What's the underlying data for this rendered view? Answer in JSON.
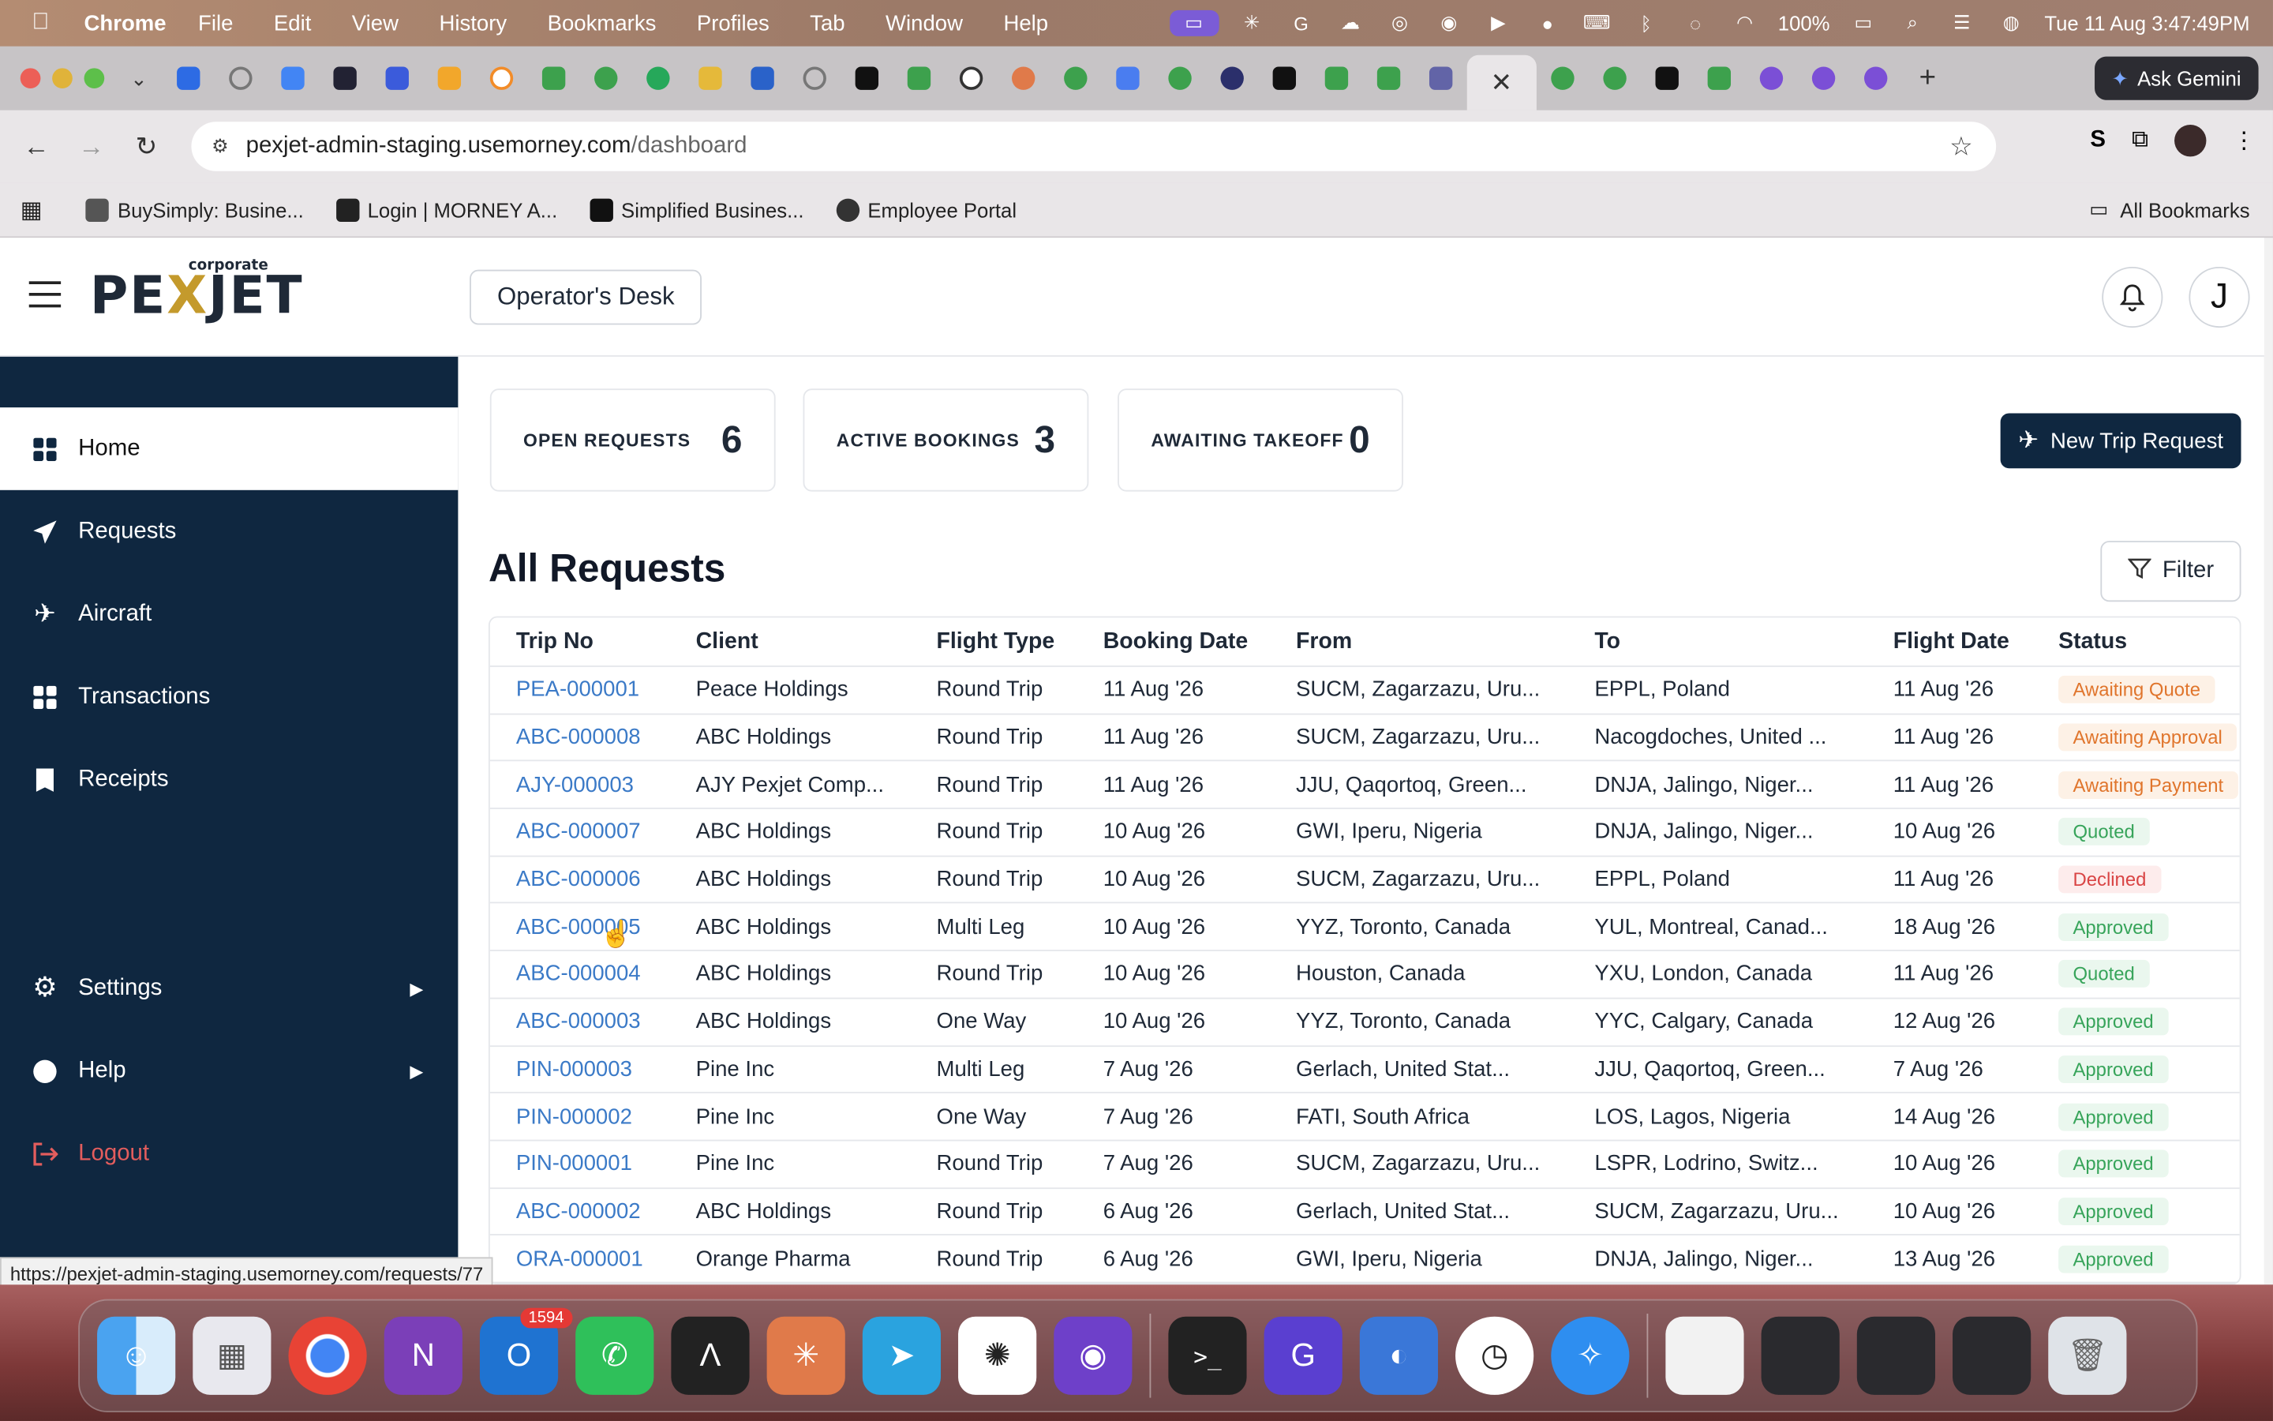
{
  "menubar": {
    "app": "Chrome",
    "items": [
      "File",
      "Edit",
      "View",
      "History",
      "Bookmarks",
      "Profiles",
      "Tab",
      "Window",
      "Help"
    ],
    "battery": "100%",
    "clock": "Tue 11 Aug  3:47:49PM"
  },
  "browser": {
    "gemini_label": "Ask Gemini",
    "url_host": "pexjet-admin-staging.usemorney.com",
    "url_path": "/dashboard",
    "bookmarks": [
      "BuySimply: Busine...",
      "Login | MORNEY A...",
      "Simplified Busines...",
      "Employee Portal"
    ],
    "all_bookmarks": "All Bookmarks",
    "status_url": "https://pexjet-admin-staging.usemorney.com/requests/77"
  },
  "app": {
    "logo_text_left": "PE",
    "logo_x": "X",
    "logo_text_right": "JET",
    "logo_sub": "corporate",
    "desk_label": "Operator's Desk",
    "avatar_initial": "J"
  },
  "sidebar": {
    "items": [
      {
        "label": "Home",
        "icon": "grid-icon"
      },
      {
        "label": "Requests",
        "icon": "send-icon"
      },
      {
        "label": "Aircraft",
        "icon": "plane-icon"
      },
      {
        "label": "Transactions",
        "icon": "grid-icon"
      },
      {
        "label": "Receipts",
        "icon": "receipt-icon"
      },
      {
        "label": "Settings",
        "icon": "gear-icon"
      },
      {
        "label": "Help",
        "icon": "help-icon"
      },
      {
        "label": "Logout",
        "icon": "logout-icon"
      }
    ]
  },
  "stats": {
    "open_label": "OPEN REQUESTS",
    "open_value": "6",
    "active_label": "ACTIVE BOOKINGS",
    "active_value": "3",
    "await_label": "AWAITING TAKEOFF",
    "await_value": "0"
  },
  "actions": {
    "new_trip": "New Trip Request",
    "filter": "Filter"
  },
  "table": {
    "title": "All Requests",
    "columns": [
      "Trip No",
      "Client",
      "Flight Type",
      "Booking Date",
      "From",
      "To",
      "Flight Date",
      "Status"
    ],
    "rows": [
      [
        "PEA-000001",
        "Peace Holdings",
        "Round Trip",
        "11 Aug '26",
        "SUCM, Zagarzazu, Uru...",
        "EPPL, Poland",
        "11 Aug '26",
        "Awaiting Quote"
      ],
      [
        "ABC-000008",
        "ABC Holdings",
        "Round Trip",
        "11 Aug '26",
        "SUCM, Zagarzazu, Uru...",
        "Nacogdoches, United ...",
        "11 Aug '26",
        "Awaiting Approval"
      ],
      [
        "AJY-000003",
        "AJY Pexjet Comp...",
        "Round Trip",
        "11 Aug '26",
        "JJU, Qaqortoq, Green...",
        "DNJA, Jalingo, Niger...",
        "11 Aug '26",
        "Awaiting Payment"
      ],
      [
        "ABC-000007",
        "ABC Holdings",
        "Round Trip",
        "10 Aug '26",
        "GWI, Iperu, Nigeria",
        "DNJA, Jalingo, Niger...",
        "10 Aug '26",
        "Quoted"
      ],
      [
        "ABC-000006",
        "ABC Holdings",
        "Round Trip",
        "10 Aug '26",
        "SUCM, Zagarzazu, Uru...",
        "EPPL, Poland",
        "11 Aug '26",
        "Declined"
      ],
      [
        "ABC-000005",
        "ABC Holdings",
        "Multi Leg",
        "10 Aug '26",
        "YYZ, Toronto, Canada",
        "YUL, Montreal, Canad...",
        "18 Aug '26",
        "Approved"
      ],
      [
        "ABC-000004",
        "ABC Holdings",
        "Round Trip",
        "10 Aug '26",
        "Houston, Canada",
        "YXU, London, Canada",
        "11 Aug '26",
        "Quoted"
      ],
      [
        "ABC-000003",
        "ABC Holdings",
        "One Way",
        "10 Aug '26",
        "YYZ, Toronto, Canada",
        "YYC, Calgary, Canada",
        "12 Aug '26",
        "Approved"
      ],
      [
        "PIN-000003",
        "Pine Inc",
        "Multi Leg",
        "7 Aug '26",
        "Gerlach, United Stat...",
        "JJU, Qaqortoq, Green...",
        "7 Aug '26",
        "Approved"
      ],
      [
        "PIN-000002",
        "Pine Inc",
        "One Way",
        "7 Aug '26",
        "FATI, South Africa",
        "LOS, Lagos, Nigeria",
        "14 Aug '26",
        "Approved"
      ],
      [
        "PIN-000001",
        "Pine Inc",
        "Round Trip",
        "7 Aug '26",
        "SUCM, Zagarzazu, Uru...",
        "LSPR, Lodrino, Switz...",
        "10 Aug '26",
        "Approved"
      ],
      [
        "ABC-000002",
        "ABC Holdings",
        "Round Trip",
        "6 Aug '26",
        "Gerlach, United Stat...",
        "SUCM, Zagarzazu, Uru...",
        "10 Aug '26",
        "Approved"
      ],
      [
        "ORA-000001",
        "Orange Pharma",
        "Round Trip",
        "6 Aug '26",
        "GWI, Iperu, Nigeria",
        "DNJA, Jalingo, Niger...",
        "13 Aug '26",
        "Approved"
      ]
    ]
  },
  "dock": {
    "mail_badge": "1594"
  },
  "colors": {
    "sidebar": "#0f2740",
    "link": "#3b7ac7",
    "accent_gold": "#c49a2c"
  }
}
